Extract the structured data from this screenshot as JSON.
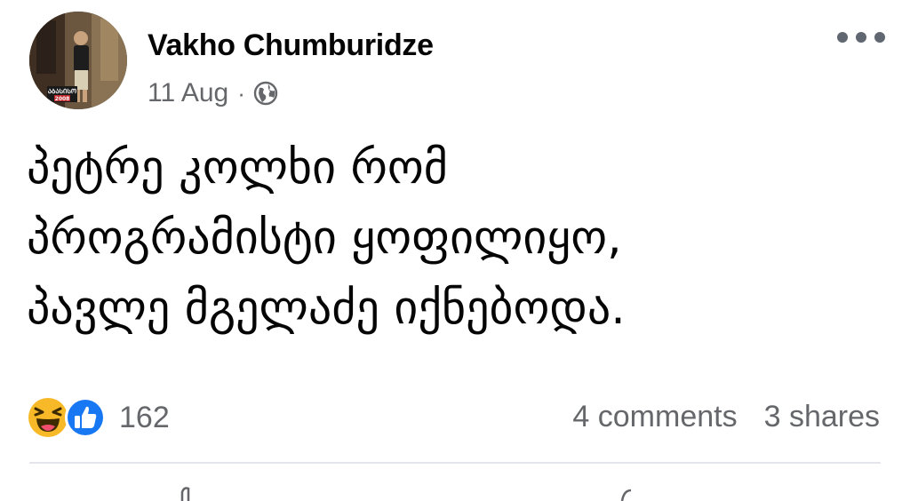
{
  "post": {
    "author": "Vakho Chumburidze",
    "date": "11 Aug",
    "separator": "·",
    "privacy_icon": "globe-icon",
    "avatar_badge_line1": "ᲐᲑᲐᲡᲘᲡᲝ",
    "avatar_badge_line2": "2008",
    "text_lines": [
      "პეტრე კოლხი რომ",
      "პროგრამისტი ყოფილიყო,",
      "პავლე მგელაძე იქნებოდა."
    ]
  },
  "reactions": {
    "icons": [
      "haha-icon",
      "like-icon"
    ],
    "count": "162"
  },
  "stats": {
    "comments": "4 comments",
    "shares": "3 shares"
  },
  "colors": {
    "text": "#050505",
    "secondary": "#65676b",
    "like_blue": "#1877f2",
    "haha_yellow": "#f7b928",
    "divider": "#e4e6eb"
  }
}
